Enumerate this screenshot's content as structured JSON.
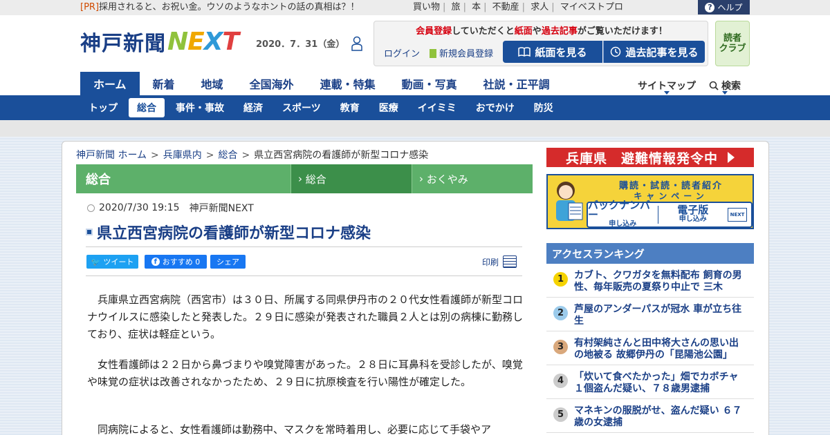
{
  "topbar": {
    "pr_tag": "[PR]",
    "pr_text": "採用されると、お祝い金。ウソのようなホントの話の真相は？！",
    "links": [
      "買い物",
      "旅",
      "本",
      "不動産",
      "求人",
      "マイベストプロ"
    ],
    "help_label": "ヘルプ"
  },
  "header": {
    "logo_jp": "神戸新聞",
    "logo_next": "NEXT",
    "date": "2020．7．31（金）",
    "member_msg_parts": [
      "会員登録",
      "していただくと",
      "紙面",
      "や",
      "過去記事",
      "がご覧いただけます！"
    ],
    "login": "ログイン",
    "new_member": "新規会員登録",
    "paper_button": "紙面を見る",
    "past_button": "過去記事を見る",
    "club_line1": "読者",
    "club_line2": "クラブ"
  },
  "main_nav": [
    "ホーム",
    "新着",
    "地域",
    "全国海外",
    "連載・特集",
    "動画・写真",
    "社説・正平調"
  ],
  "sitemap": "サイトマップ",
  "search": "検索",
  "sub_nav": [
    "トップ",
    "総合",
    "事件・事故",
    "経済",
    "スポーツ",
    "教育",
    "医療",
    "イイミミ",
    "おでかけ",
    "防災"
  ],
  "breadcrumb": [
    "神戸新聞 ホーム",
    "兵庫県内",
    "総合",
    "県立西宮病院の看護師が新型コロナ感染"
  ],
  "section": {
    "title": "総合",
    "tab1": "総合",
    "tab2": "おくやみ"
  },
  "article": {
    "datetime": "2020/7/30 19:15",
    "source": "神戸新聞NEXT",
    "headline": "県立西宮病院の看護師が新型コロナ感染",
    "tweet": "ツイート",
    "fb_recommend": "おすすめ 0",
    "fb_share": "シェア",
    "print": "印刷",
    "paragraphs": [
      "兵庫県立西宮病院（西宮市）は３０日、所属する同県伊丹市の２０代女性看護師が新型コロナウイルスに感染したと発表した。２９日に感染が発表された職員２人とは別の病棟に勤務しており、症状は軽症という。",
      "女性看護師は２２日から鼻づまりや嗅覚障害があった。２８日に耳鼻科を受診したが、嗅覚や味覚の症状は改善されなかったため、２９日に抗原検査を行い陽性が確定した。",
      "同病院によると、女性看護師は勤務中、マスクを常時着用し、必要に応じて手袋やア"
    ]
  },
  "sidebar": {
    "alert_banner": "兵庫県　避難情報発令中",
    "campaign_line1": "購読・試読・読者紹介",
    "campaign_line2": "キャンペーン",
    "backnumber": "バックナンバー",
    "backnumber_sub": "申し込み",
    "digital": "電子版",
    "digital_sub": "申し込み",
    "next_mini": "NEXT",
    "ranking_title": "アクセスランキング",
    "ranking": [
      {
        "num": "1",
        "text": "カブト、クワガタを無料配布 飼育の男性、毎年販売の夏祭り中止で 三木"
      },
      {
        "num": "2",
        "text": "芦屋のアンダーパスが冠水 車が立ち往生"
      },
      {
        "num": "3",
        "text": "有村架純さんと田中将大さんの思い出の地被る 故郷伊丹の「昆陽池公園」"
      },
      {
        "num": "4",
        "text": "「炊いて食べたかった」畑でカボチャ１個盗んだ疑い、７８歳男逮捕"
      },
      {
        "num": "5",
        "text": "マネキンの服脱がせ、盗んだ疑い ６７歳の女逮捕"
      }
    ]
  },
  "colors": {
    "brand_blue": "#1a4f9a",
    "nav_text": "#1a3f86",
    "section_green": "#5db06a",
    "alert_red": "#d52b2b",
    "ranking_blue": "#4d7fc2"
  }
}
